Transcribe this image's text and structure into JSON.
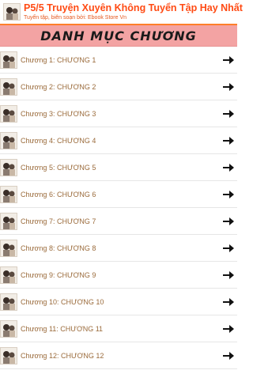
{
  "header": {
    "title": "P5/5 Truyện Xuyên Không Tuyển Tập Hay Nhất",
    "subtitle": "Tuyển tập, biên soạn bởi: Ebook Store Vn"
  },
  "banner": {
    "title": "DANH MỤC CHƯƠNG"
  },
  "chapters": [
    {
      "label": "Chương 1: CHƯƠNG 1"
    },
    {
      "label": "Chương 2: CHƯƠNG 2"
    },
    {
      "label": "Chương 3: CHƯƠNG 3"
    },
    {
      "label": "Chương 4: CHƯƠNG 4"
    },
    {
      "label": "Chương 5: CHƯƠNG 5"
    },
    {
      "label": "Chương 6: CHƯƠNG 6"
    },
    {
      "label": "Chương 7: CHƯƠNG 7"
    },
    {
      "label": "Chương 8: CHƯƠNG 8"
    },
    {
      "label": "Chương 9: CHƯƠNG 9"
    },
    {
      "label": "Chương 10: CHƯƠNG 10"
    },
    {
      "label": "Chương 11: CHƯƠNG 11"
    },
    {
      "label": "Chương 12: CHƯƠNG 12"
    }
  ],
  "colors": {
    "title": "#ff4b14",
    "banner_bg": "#f3a3a3",
    "row_text": "#9a6a3a"
  },
  "icons": {
    "thumb": "book-cover-thumbnail-icon",
    "row_action": "arrow-right-icon"
  }
}
